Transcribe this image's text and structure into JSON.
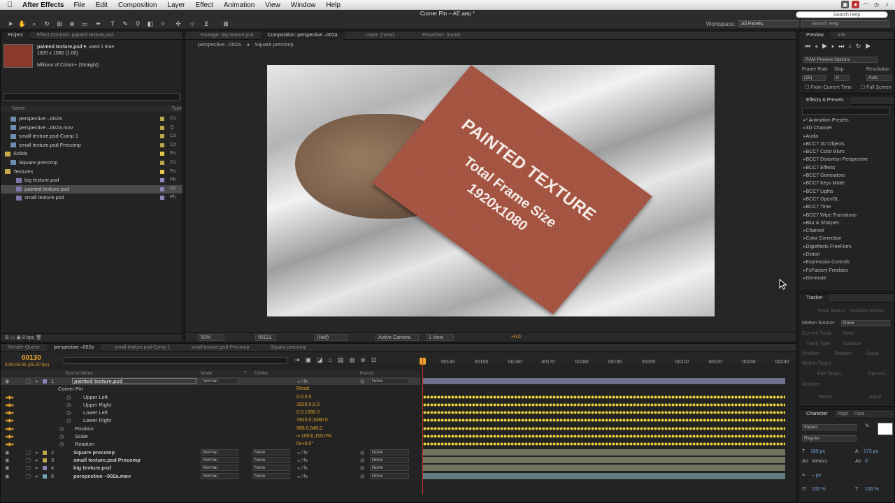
{
  "menubar": {
    "app": "After Effects",
    "items": [
      "File",
      "Edit",
      "Composition",
      "Layer",
      "Effect",
      "Animation",
      "View",
      "Window",
      "Help"
    ]
  },
  "window_title": "Corner Pin – AE.aep *",
  "search_help_placeholder": "Search Help",
  "toolbar": {
    "workspace_label": "Workspace:",
    "workspace_value": "All Panels"
  },
  "project_panel": {
    "tabs": [
      "Project",
      "Effect Controls: painted texture.psd"
    ],
    "selected_name": "painted texture.psd ▾",
    "used_count": ", used 1 time",
    "dimensions": "1920 x 1080 (1.00)",
    "colors": "Millions of Colors+ (Straight)",
    "col_name": "Name",
    "col_type": "Type",
    "items": [
      {
        "name": "perspective –002a",
        "type": "Co",
        "color": "#b9a64a",
        "indent": 1,
        "icon": "comp",
        "selected": false
      },
      {
        "name": "perspective –002a.mov",
        "type": "Q",
        "color": "#b9a64a",
        "indent": 1,
        "icon": "footage",
        "selected": false
      },
      {
        "name": "small texture.psd Comp 1",
        "type": "Co",
        "color": "#b9a64a",
        "indent": 1,
        "icon": "comp",
        "selected": false
      },
      {
        "name": "small texture.psd Precomp",
        "type": "Co",
        "color": "#b9a64a",
        "indent": 1,
        "icon": "comp",
        "selected": false
      },
      {
        "name": "Solids",
        "type": "Fo",
        "color": "#e3c64a",
        "indent": 0,
        "icon": "folder",
        "selected": false
      },
      {
        "name": "Square precomp",
        "type": "Co",
        "color": "#b9a64a",
        "indent": 1,
        "icon": "comp",
        "selected": false
      },
      {
        "name": "Textures",
        "type": "Fo",
        "color": "#e3c64a",
        "indent": 0,
        "icon": "folder",
        "selected": false
      },
      {
        "name": "big texture.psd",
        "type": "Ph",
        "color": "#8d86b8",
        "indent": 2,
        "icon": "image",
        "selected": false
      },
      {
        "name": "painted texture.psd",
        "type": "Ph",
        "color": "#8d86b8",
        "indent": 2,
        "icon": "image",
        "selected": true
      },
      {
        "name": "small texture.psd",
        "type": "Ph",
        "color": "#8d86b8",
        "indent": 2,
        "icon": "image",
        "selected": false
      }
    ],
    "bpc": "8 bpc"
  },
  "composition_panel": {
    "tabs": [
      "Footage: big texture.psd",
      "Composition: perspective –002a",
      "Layer: (none)",
      "Flowchart: (none)"
    ],
    "breadcrumb": [
      "perspective –002a",
      "Square precomp"
    ],
    "card_title": "PAINTED TEXTURE",
    "card_line2": "Total Frame Size",
    "card_line3": "1920x1080",
    "footer": {
      "zoom": "50%",
      "timecode": "00131",
      "resolution": "(Half)",
      "camera": "Active Camera",
      "views": "1 View",
      "exposure": "+0.0"
    }
  },
  "preview_panel": {
    "tabs": [
      "Preview",
      "Info"
    ],
    "ram_options": "RAM Preview Options",
    "frame_rate_label": "Frame Rate",
    "skip_label": "Skip",
    "resolution_label": "Resolution",
    "frame_rate_value": "(25)",
    "skip_value": "0",
    "resolution_value": "Auto",
    "from_current": "From Current Time",
    "full_screen": "Full Screen"
  },
  "effects_panel": {
    "title": "Effects & Presets",
    "items": [
      "* Animation Presets",
      "3D Channel",
      "Audio",
      "BCC7 3D Objects",
      "BCC7 Color Blurs",
      "BCC7 Distortion Perspective",
      "BCC7 Effects",
      "BCC7 Generators",
      "BCC7 Keys Matte",
      "BCC7 Lights",
      "BCC7 OpenGL",
      "BCC7 Time",
      "BCC7 Wipe Transitions",
      "Blur & Sharpen",
      "Channel",
      "Color Correction",
      "Digieffects FreeForm",
      "Distort",
      "Expression Controls",
      "FxFactory Freebies",
      "Generate"
    ]
  },
  "tracker_panel": {
    "title": "Tracker",
    "track_motion": "Track Motion",
    "stabilize_motion": "Stabilize Motion",
    "motion_source_label": "Motion Source:",
    "motion_source_value": "None",
    "current_track_label": "Current Track:",
    "current_track_value": "None",
    "track_type_label": "Track Type:",
    "track_type_value": "Stabilize",
    "position": "Position",
    "rotation": "Rotation",
    "scale": "Scale",
    "motion_target": "Motion Target:",
    "edit_target": "Edit Target...",
    "options": "Options...",
    "analyze": "Analyze:",
    "reset": "Reset",
    "apply": "Apply"
  },
  "character_panel": {
    "tabs": [
      "Character",
      "Align",
      "Para"
    ],
    "font": "Impact",
    "style": "Regular",
    "size": "189 px",
    "leading": "173 px",
    "kerning": "Metrics",
    "tracking": "0",
    "stroke": "– px",
    "vscale": "100 %",
    "hscale": "100 %"
  },
  "timeline_panel": {
    "tabs": [
      "Render Queue",
      "perspective –002a",
      "small texture.psd Comp 1",
      "small texture.psd Precomp",
      "Square precomp"
    ],
    "timecode": "00130",
    "timecode_sub": "0:00:05:05 (25.00 fps)",
    "col_source": "Source Name",
    "col_mode": "Mode",
    "col_t": "T",
    "col_trkmat": "TrkMat",
    "col_parent": "Parent",
    "ruler": [
      "00140",
      "00150",
      "00160",
      "00170",
      "00180",
      "00190",
      "00200",
      "00210",
      "00220",
      "00230",
      "00240"
    ],
    "layers": [
      {
        "kind": "layer",
        "num": "1",
        "name": "painted texture.psd",
        "mode": "Normal",
        "trk": "",
        "parent": "None",
        "selected": true,
        "color": "#8d86b8"
      },
      {
        "kind": "effect",
        "name": "Corner Pin",
        "value": "Reset"
      },
      {
        "kind": "prop",
        "name": "Upper Left",
        "value": "0.0,0.0",
        "kf": true
      },
      {
        "kind": "prop",
        "name": "Upper Right",
        "value": "1920.0,0.0",
        "kf": true
      },
      {
        "kind": "prop",
        "name": "Lower Left",
        "value": "0.0,1080.0",
        "kf": true
      },
      {
        "kind": "prop",
        "name": "Lower Right",
        "value": "1920.0,1080.0",
        "kf": true
      },
      {
        "kind": "prop2",
        "name": "Position",
        "value": "960.0,540.0",
        "kf": true
      },
      {
        "kind": "prop2",
        "name": "Scale",
        "value": "∞ 100.0,100.0%",
        "kf": true
      },
      {
        "kind": "prop2",
        "name": "Rotation",
        "value": "0x+0.0°",
        "kf": true
      },
      {
        "kind": "layer",
        "num": "2",
        "name": "Square precomp",
        "mode": "Normal",
        "trk": "None",
        "parent": "None",
        "selected": false,
        "color": "#b9a64a"
      },
      {
        "kind": "layer",
        "num": "3",
        "name": "small texture.psd Precomp",
        "mode": "Normal",
        "trk": "None",
        "parent": "None",
        "selected": false,
        "color": "#b9a64a"
      },
      {
        "kind": "layer",
        "num": "4",
        "name": "big texture.psd",
        "mode": "Normal",
        "trk": "None",
        "parent": "None",
        "selected": false,
        "color": "#8d86b8"
      },
      {
        "kind": "layer",
        "num": "5",
        "name": "perspective –002a.mov",
        "mode": "Normal",
        "trk": "None",
        "parent": "None",
        "selected": false,
        "color": "#6fa7b5"
      }
    ]
  },
  "colors": {
    "accent_timecode": "#e8a42a",
    "keyframe": "#e8d23a",
    "playhead": "#d0372a",
    "card": "#a35240"
  }
}
